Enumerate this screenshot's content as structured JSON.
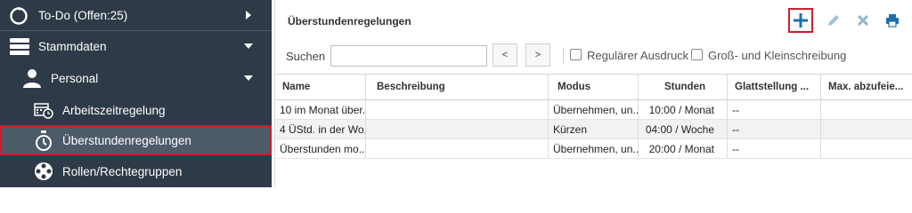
{
  "sidebar": {
    "todo": {
      "label": "To-Do (Offen:25)"
    },
    "stammdaten": {
      "label": "Stammdaten"
    },
    "personal": {
      "label": "Personal"
    },
    "items": [
      {
        "label": "Arbeitszeitregelung"
      },
      {
        "label": "Überstundenregelungen"
      },
      {
        "label": "Rollen/Rechtegruppen"
      }
    ]
  },
  "panel": {
    "title": "Überstundenregelungen",
    "toolbar": {
      "add_icon": "plus-icon",
      "edit_icon": "pencil-icon",
      "delete_icon": "close-icon",
      "print_icon": "printer-icon"
    }
  },
  "filters": {
    "search_label": "Suchen",
    "search_value": "",
    "prev_label": "<",
    "next_label": ">",
    "checkbox_regular": {
      "label": "Regulärer Ausdruck",
      "checked": false
    },
    "checkbox_case": {
      "label": "Groß- und Kleinschreibung",
      "checked": false
    }
  },
  "table": {
    "columns": [
      "Name",
      "Beschreibung",
      "Modus",
      "Stunden",
      "Glattstellung ...",
      "Max. abzufeie..."
    ],
    "rows": [
      [
        "10 im Monat über...",
        "",
        "Übernehmen, un...",
        "10:00 / Monat",
        "--",
        ""
      ],
      [
        "4 ÜStd. in der Wo...",
        "",
        "Kürzen",
        "04:00 / Woche",
        "--",
        ""
      ],
      [
        "Überstunden mo...",
        "",
        "Übernehmen, un...",
        "20:00 / Monat",
        "--",
        ""
      ]
    ]
  },
  "colors": {
    "sidebar_bg": "#2e3a47",
    "accent_blue": "#1f6fb2",
    "highlight_red": "#c8202f"
  }
}
